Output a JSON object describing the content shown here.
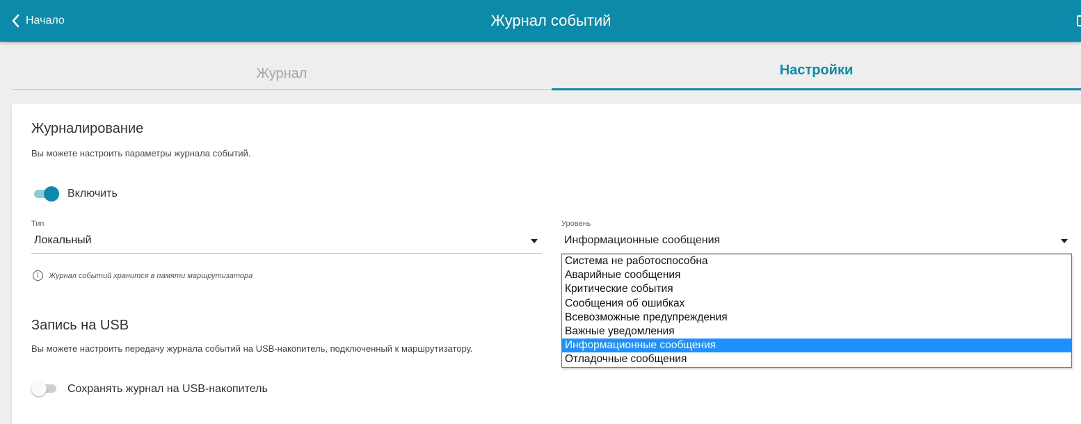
{
  "header": {
    "back_label": "Начало",
    "title": "Журнал событий"
  },
  "tabs": [
    {
      "label": "Журнал",
      "active": false
    },
    {
      "label": "Настройки",
      "active": true
    }
  ],
  "logging": {
    "title": "Журналирование",
    "description": "Вы можете настроить параметры журнала событий.",
    "enable_label": "Включить",
    "enable_on": true,
    "type_label": "Тип",
    "type_value": "Локальный",
    "level_label": "Уровень",
    "level_value": "Информационные сообщения",
    "hint": "Журнал событий хранится в памяти маршрутизатора",
    "level_options": [
      "Система не работоспособна",
      "Аварийные сообщения",
      "Критические события",
      "Сообщения об ошибках",
      "Всевозможные предупреждения",
      "Важные уведомления",
      "Информационные сообщения",
      "Отладочные сообщения"
    ],
    "level_selected_index": 6
  },
  "usb": {
    "title": "Запись на USB",
    "description": "Вы можете настроить передачу журнала событий на USB-накопитель, подключенный к маршрутизатору.",
    "save_label": "Сохранять журнал на USB-накопитель",
    "save_on": false
  },
  "colors": {
    "accent": "#0b8aa9",
    "selected_option": "#1e90ff"
  },
  "icons": {
    "back": "chevron-left-icon",
    "info": "info-icon",
    "dropdown": "caret-down-icon"
  }
}
